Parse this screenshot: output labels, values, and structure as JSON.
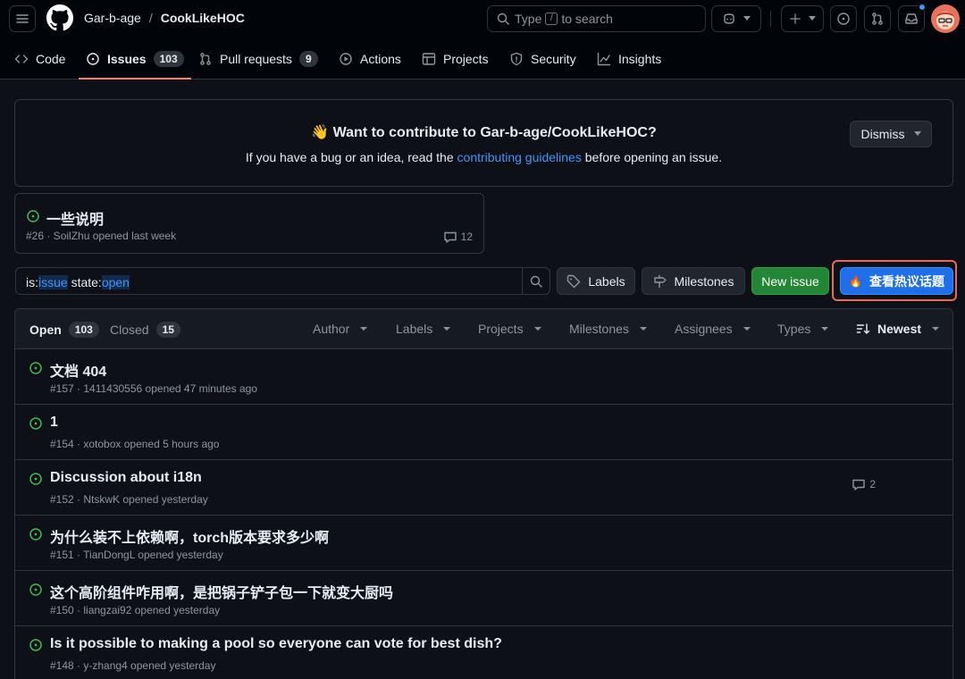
{
  "header": {
    "owner": "Gar-b-age",
    "separator": "/",
    "repo": "CookLikeHOC",
    "search_pre": "Type",
    "search_key": "/",
    "search_post": "to search"
  },
  "nav": {
    "tabs": [
      {
        "label": "Code",
        "icon": "code-icon"
      },
      {
        "label": "Issues",
        "count": "103",
        "icon": "issue-opened-icon",
        "active": true
      },
      {
        "label": "Pull requests",
        "count": "9",
        "icon": "git-pull-request-icon"
      },
      {
        "label": "Actions",
        "icon": "play-icon"
      },
      {
        "label": "Projects",
        "icon": "table-icon"
      },
      {
        "label": "Security",
        "icon": "shield-icon"
      },
      {
        "label": "Insights",
        "icon": "graph-icon"
      }
    ]
  },
  "banner": {
    "emoji": "👋",
    "title": "Want to contribute to Gar-b-age/CookLikeHOC?",
    "desc_pre": "If you have a bug or an idea, read the",
    "desc_link": "contributing guidelines",
    "desc_post": "before opening an issue.",
    "dismiss": "Dismiss"
  },
  "pinned": {
    "title": "一些说明",
    "meta": "#26 · SoilZhu opened last week",
    "comments": "12"
  },
  "filter": {
    "q1": "is:",
    "q2": "issue",
    "q3": " state:",
    "q4": "open",
    "labels": "Labels",
    "milestones": "Milestones",
    "new_issue": "New issue",
    "hot_emoji": "🔥",
    "hot_topics": "查看热议话题"
  },
  "list": {
    "open_label": "Open",
    "open_count": "103",
    "closed_label": "Closed",
    "closed_count": "15",
    "menus": [
      "Author",
      "Labels",
      "Projects",
      "Milestones",
      "Assignees",
      "Types"
    ],
    "sort": "Newest",
    "issues": [
      {
        "title": "文档 404",
        "meta": "#157 · 1411430556 opened 47 minutes ago",
        "comments": ""
      },
      {
        "title": "1",
        "meta": "#154 · xotobox opened 5 hours ago",
        "comments": ""
      },
      {
        "title": "Discussion about i18n",
        "meta": "#152 · NtskwK opened yesterday",
        "comments": "2"
      },
      {
        "title": "为什么装不上依赖啊，torch版本要求多少啊",
        "meta": "#151 · TianDongL opened yesterday",
        "comments": ""
      },
      {
        "title": "这个高阶组件咋用啊，是把锅子铲子包一下就变大厨吗",
        "meta": "#150 · liangzai92 opened yesterday",
        "comments": ""
      },
      {
        "title": "Is it possible to making a pool so everyone can vote for best dish?",
        "meta": "#148 · y-zhang4 opened yesterday",
        "comments": ""
      }
    ]
  },
  "colors": {
    "accent_green": "#3fb950",
    "tab_underline": "#f78166",
    "link": "#4493f8",
    "highlight_border": "#f0675a"
  }
}
